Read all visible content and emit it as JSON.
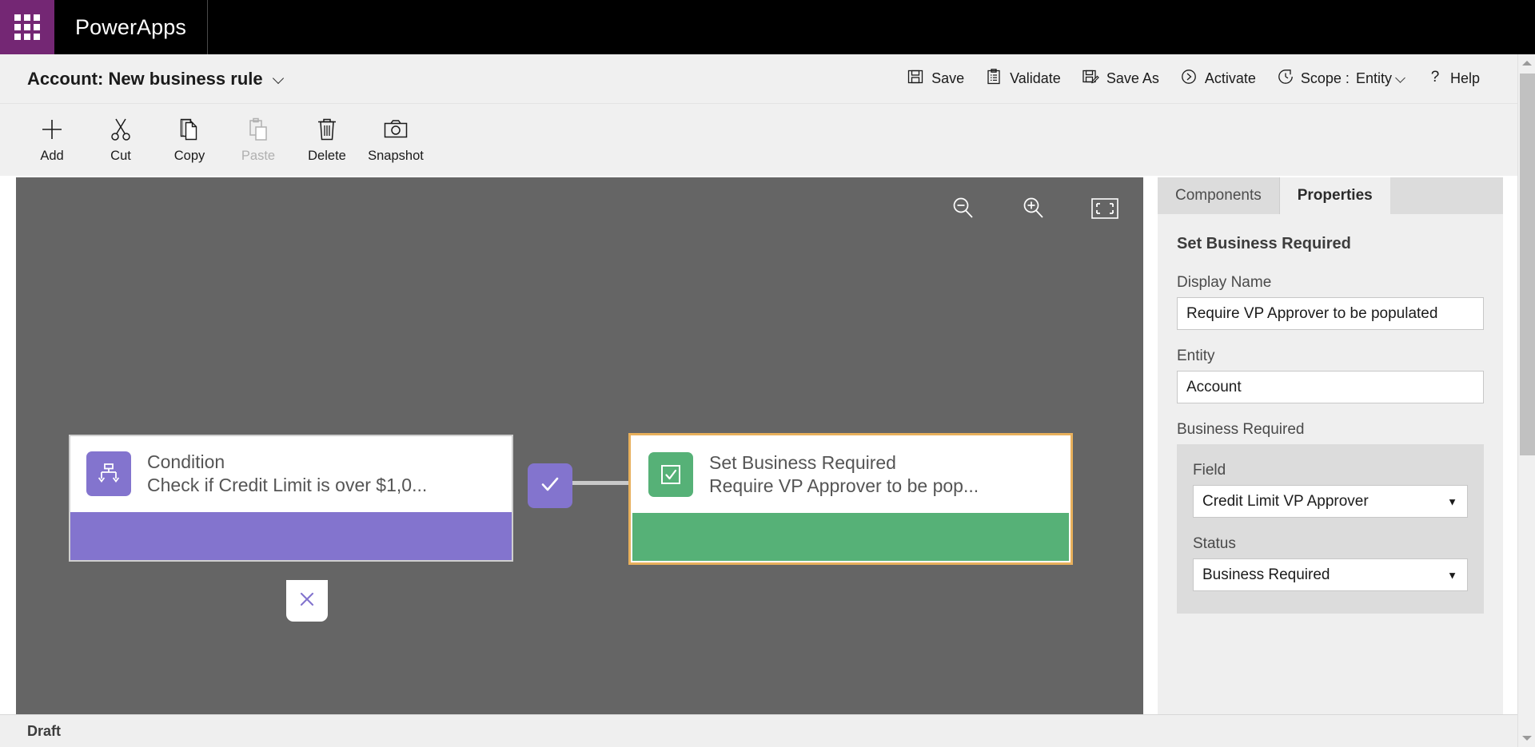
{
  "top_bar": {
    "waffle_icon": "app-launcher-icon",
    "brand": "PowerApps"
  },
  "command_bar": {
    "rule_title": "Account: New business rule",
    "title_chevron_icon": "chevron-down-icon",
    "actions": [
      {
        "label": "Save",
        "icon": "save-icon",
        "enabled": true
      },
      {
        "label": "Validate",
        "icon": "validate-clipboard-icon",
        "enabled": true
      },
      {
        "label": "Save As",
        "icon": "save-as-icon",
        "enabled": true
      },
      {
        "label": "Activate",
        "icon": "activate-play-icon",
        "enabled": true
      }
    ],
    "scope": {
      "icon": "scope-clock-icon",
      "label": "Scope :",
      "value": "Entity",
      "chevron_icon": "chevron-down-icon"
    },
    "help": {
      "icon": "question-mark-icon",
      "label": "Help"
    }
  },
  "toolbar": {
    "items": [
      {
        "label": "Add",
        "icon": "plus-icon",
        "enabled": true
      },
      {
        "label": "Cut",
        "icon": "scissors-icon",
        "enabled": true
      },
      {
        "label": "Copy",
        "icon": "copy-icon",
        "enabled": true
      },
      {
        "label": "Paste",
        "icon": "paste-clipboard-icon",
        "enabled": false
      },
      {
        "label": "Delete",
        "icon": "trash-icon",
        "enabled": true
      },
      {
        "label": "Snapshot",
        "icon": "camera-icon",
        "enabled": true
      }
    ]
  },
  "canvas": {
    "background_color": "#656565",
    "zoom_controls": [
      {
        "name": "zoom-out",
        "icon": "magnifier-minus-icon"
      },
      {
        "name": "zoom-in",
        "icon": "magnifier-plus-icon"
      },
      {
        "name": "fit-to-screen",
        "icon": "fit-screen-icon"
      }
    ],
    "nodes": [
      {
        "type": "condition",
        "icon": "condition-branch-icon",
        "title": "Condition",
        "subtitle": "Check if Credit Limit is over $1,0...",
        "accent_color": "#8374ce",
        "selected": false
      },
      {
        "type": "action",
        "icon": "checkbox-checked-icon",
        "title": "Set Business Required",
        "subtitle": "Require VP Approver to be pop...",
        "accent_color": "#56b177",
        "selected": true,
        "selection_color": "#e8b05c"
      }
    ],
    "branches": {
      "yes": {
        "icon": "checkmark-icon",
        "color": "#8374ce"
      },
      "no": {
        "icon": "close-x-icon",
        "color": "#8374ce"
      }
    }
  },
  "right_panel": {
    "tabs": [
      {
        "label": "Components",
        "active": false
      },
      {
        "label": "Properties",
        "active": true
      }
    ],
    "heading": "Set Business Required",
    "display_name": {
      "label": "Display Name",
      "value": "Require VP Approver to be populated"
    },
    "entity": {
      "label": "Entity",
      "value": "Account"
    },
    "business_required": {
      "label": "Business Required",
      "field": {
        "label": "Field",
        "value": "Credit Limit VP Approver",
        "caret_icon": "caret-down-icon"
      },
      "status": {
        "label": "Status",
        "value": "Business Required",
        "caret_icon": "caret-down-icon"
      }
    }
  },
  "status_bar": {
    "text": "Draft"
  },
  "scrollbar": {
    "up_icon": "scroll-up-arrow-icon",
    "down_icon": "scroll-down-arrow-icon"
  }
}
